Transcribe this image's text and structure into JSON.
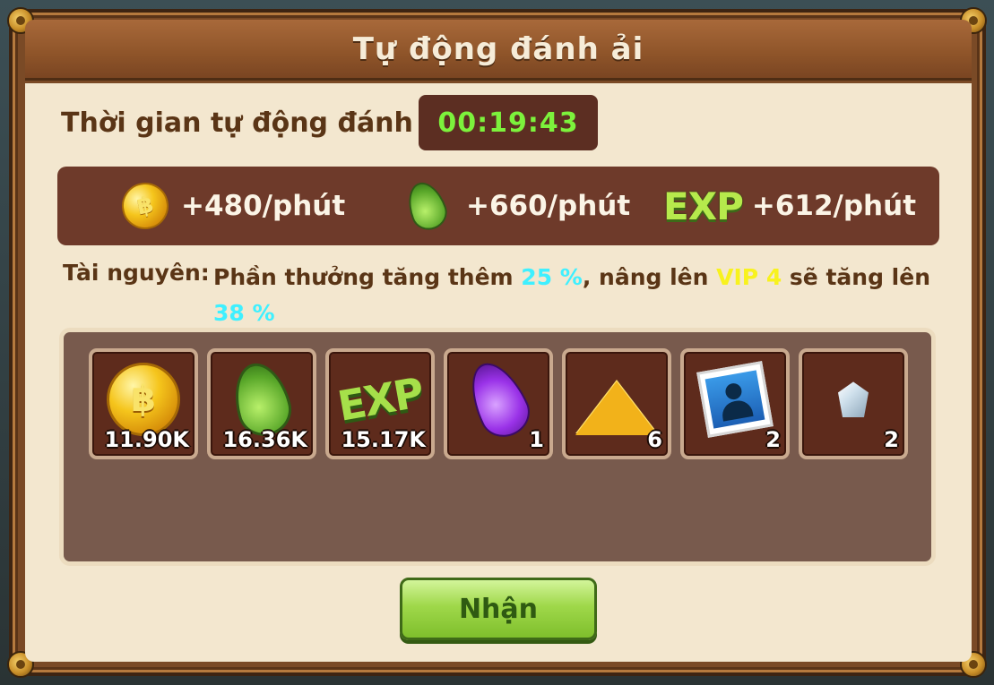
{
  "dialog": {
    "title": "Tự động đánh ải"
  },
  "timer": {
    "label": "Thời gian tự động đánh ải",
    "value": "00:19:43"
  },
  "rates": [
    {
      "icon": "coin-icon",
      "text": "+480/phút"
    },
    {
      "icon": "leaf-icon",
      "text": "+660/phút"
    },
    {
      "icon": "exp-icon",
      "label": "EXP",
      "text": "+612/phút"
    }
  ],
  "info": {
    "label": "Tài nguyên:",
    "prefix": "Phần thưởng tăng thêm ",
    "bonus": "25 %",
    "middle": ", nâng lên ",
    "vip": "VIP 4",
    "suffix": " sẽ tăng lên ",
    "next_bonus": "38 %"
  },
  "rewards": [
    {
      "icon": "coin-icon",
      "count": "11.90K"
    },
    {
      "icon": "leaf-icon",
      "count": "16.36K"
    },
    {
      "icon": "exp-icon",
      "label": "EXP",
      "count": "15.17K"
    },
    {
      "icon": "purple-leaf-icon",
      "count": "1"
    },
    {
      "icon": "gold-sand-icon",
      "count": "6"
    },
    {
      "icon": "portrait-card-icon",
      "count": "2"
    },
    {
      "icon": "crystal-icon",
      "count": "2"
    }
  ],
  "claim_button": {
    "label": "Nhận"
  },
  "colors": {
    "timer": "#7cf23c",
    "bonus_cyan": "#3ff0ff",
    "vip_yellow": "#f8f21e",
    "button_green": "#9fd84a"
  }
}
